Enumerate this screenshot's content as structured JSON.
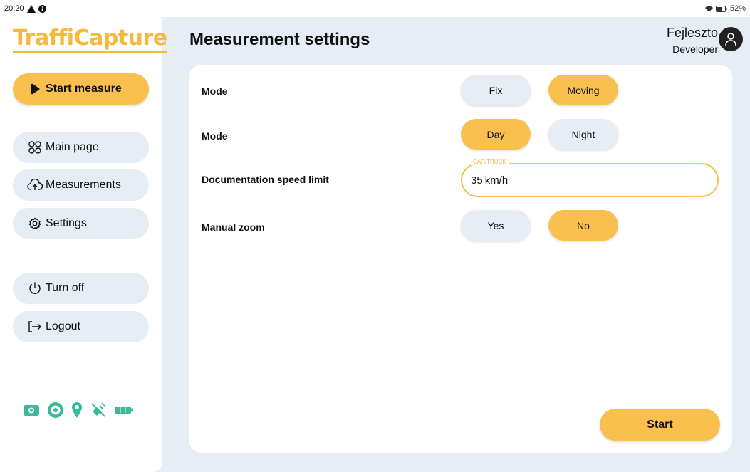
{
  "statusbar": {
    "time": "20:20",
    "battery": "52%"
  },
  "logo": "TraffiCapture",
  "sidebar": {
    "start_measure": "Start measure",
    "items": [
      {
        "label": "Main page",
        "icon": "grid-icon"
      },
      {
        "label": "Measurements",
        "icon": "cloud-upload-icon"
      },
      {
        "label": "Settings",
        "icon": "gear-icon"
      }
    ],
    "turn_off": "Turn off",
    "logout": "Logout",
    "status_icons": [
      "camera-icon",
      "radar-icon",
      "location-pin-icon",
      "satellite-off-icon",
      "battery-icon"
    ]
  },
  "header": {
    "title": "Measurement settings",
    "user_name": "Fejleszto",
    "user_role": "Developer"
  },
  "settings": {
    "mode1": {
      "label": "Mode",
      "options": [
        "Fix",
        "Moving"
      ],
      "selected": "Moving"
    },
    "mode2": {
      "label": "Mode",
      "options": [
        "Day",
        "Night"
      ],
      "selected": "Day"
    },
    "speed": {
      "label": "Documentation speed limit",
      "legend": "CAR/TRUCK",
      "value": "35",
      "unit": "km/h"
    },
    "zoom": {
      "label": "Manual zoom",
      "options": [
        "Yes",
        "No"
      ],
      "selected": "No"
    }
  },
  "start_label": "Start",
  "colors": {
    "accent": "#f9c04e",
    "background": "#e6edf5",
    "icon_green": "#3cb89a"
  }
}
